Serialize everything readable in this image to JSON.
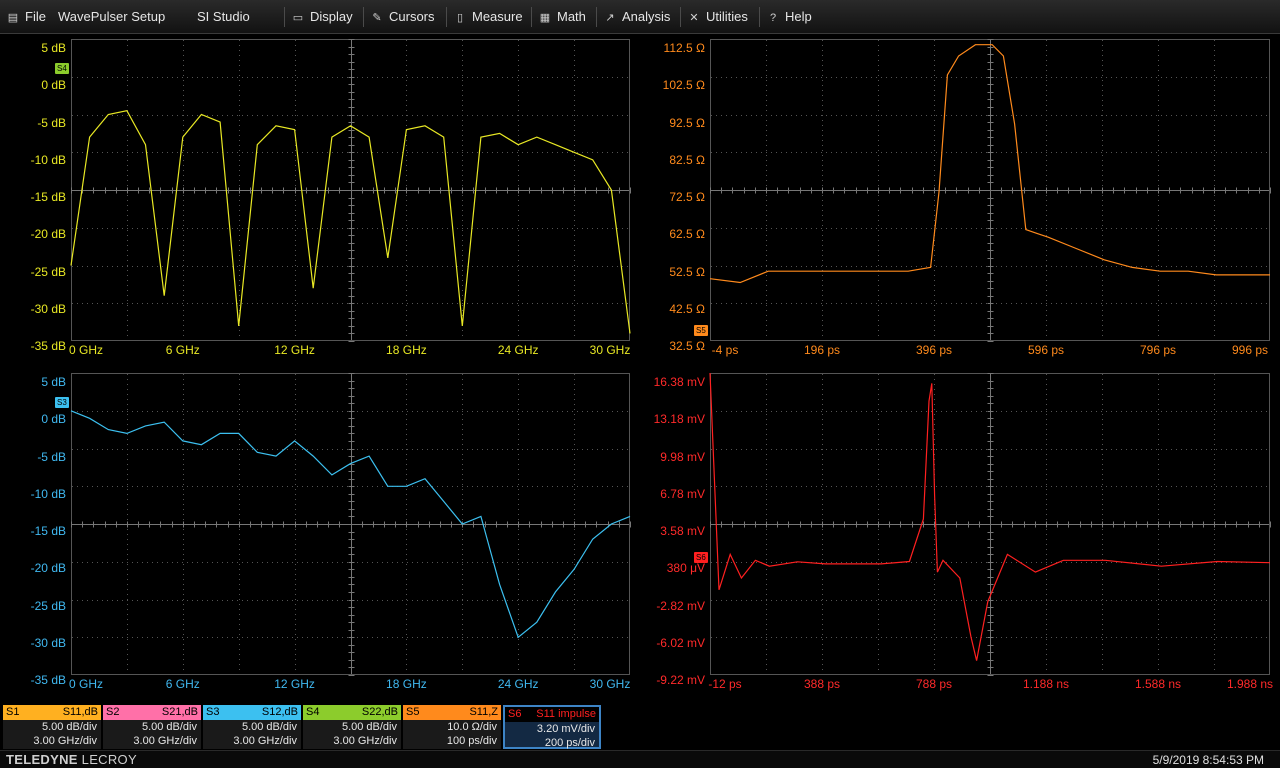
{
  "menubar": {
    "items": [
      {
        "label": "File",
        "icon": "clipboard-icon",
        "glyph": "▤"
      },
      {
        "label": "WavePulser Setup",
        "icon": "",
        "glyph": ""
      },
      {
        "label": "SI Studio",
        "icon": "",
        "glyph": ""
      },
      {
        "label": "Display",
        "icon": "display-icon",
        "glyph": "▭"
      },
      {
        "label": "Cursors",
        "icon": "cursor-icon",
        "glyph": "✎"
      },
      {
        "label": "Measure",
        "icon": "measure-icon",
        "glyph": "▯"
      },
      {
        "label": "Math",
        "icon": "math-icon",
        "glyph": "▦"
      },
      {
        "label": "Analysis",
        "icon": "analysis-icon",
        "glyph": "↗"
      },
      {
        "label": "Utilities",
        "icon": "utilities-icon",
        "glyph": "✕"
      },
      {
        "label": "Help",
        "icon": "help-icon",
        "glyph": "?"
      }
    ]
  },
  "grids": {
    "top_left": {
      "color": "#e8e824",
      "label_color": "#e8e824",
      "y_labels": [
        "5 dB",
        "0 dB",
        "-5 dB",
        "-10 dB",
        "-15 dB",
        "-20 dB",
        "-25 dB",
        "-30 dB",
        "-35 dB"
      ],
      "x_labels": [
        "0 GHz",
        "6 GHz",
        "12 GHz",
        "18 GHz",
        "24 GHz",
        "30 GHz"
      ],
      "marker": {
        "text": "S4",
        "color": "#8ccc2c"
      }
    },
    "bottom_left": {
      "color": "#3cc0f0",
      "label_color": "#40b8f0",
      "y_labels": [
        "5 dB",
        "0 dB",
        "-5 dB",
        "-10 dB",
        "-15 dB",
        "-20 dB",
        "-25 dB",
        "-30 dB",
        "-35 dB"
      ],
      "x_labels": [
        "0 GHz",
        "6 GHz",
        "12 GHz",
        "18 GHz",
        "24 GHz",
        "30 GHz"
      ],
      "marker": {
        "text": "S3",
        "color": "#3cc0f0"
      }
    },
    "top_right": {
      "color": "#ff8a1c",
      "label_color": "#ff8a1c",
      "y_labels": [
        "112.5 Ω",
        "102.5 Ω",
        "92.5 Ω",
        "82.5 Ω",
        "72.5 Ω",
        "62.5 Ω",
        "52.5 Ω",
        "42.5 Ω",
        "32.5 Ω"
      ],
      "x_labels": [
        "-4 ps",
        "196 ps",
        "396 ps",
        "596 ps",
        "796 ps",
        "996 ps"
      ],
      "marker": {
        "text": "S5",
        "color": "#ff8a1c"
      }
    },
    "bottom_right": {
      "color": "#ff2020",
      "label_color": "#ff2a2a",
      "y_labels": [
        "16.38 mV",
        "13.18 mV",
        "9.98 mV",
        "6.78 mV",
        "3.58 mV",
        "380 μV",
        "-2.82 mV",
        "-6.02 mV",
        "-9.22 mV"
      ],
      "x_labels": [
        "-12 ps",
        "388 ps",
        "788 ps",
        "1.188 ns",
        "1.588 ns",
        "1.988 ns"
      ],
      "marker": {
        "text": "S6",
        "color": "#ff2020"
      }
    }
  },
  "chart_data": [
    {
      "type": "line",
      "x": [
        0,
        1,
        2,
        3,
        4,
        5,
        6,
        7,
        8,
        9,
        10,
        11,
        12,
        13,
        14,
        15,
        16,
        17,
        18,
        19,
        20,
        21,
        22,
        23,
        24,
        25,
        26,
        27,
        28,
        29,
        30
      ],
      "series": [
        {
          "values": [
            -25,
            -8,
            -5,
            -4.5,
            -9,
            -29,
            -8,
            -5,
            -6,
            -33,
            -9,
            -6.5,
            -7,
            -28,
            -8,
            -6.5,
            -8,
            -24,
            -7,
            -6.5,
            -8,
            -33,
            -8,
            -7.5,
            -9,
            -8,
            -9,
            -10,
            -11,
            -15,
            -34
          ]
        }
      ],
      "ylim": [
        -35,
        5
      ],
      "xlim": [
        0,
        30
      ]
    },
    {
      "type": "line",
      "x": [
        0,
        1,
        2,
        3,
        4,
        5,
        6,
        7,
        8,
        9,
        10,
        11,
        12,
        13,
        14,
        15,
        16,
        17,
        18,
        19,
        20,
        21,
        22,
        23,
        24,
        25,
        26,
        27,
        28,
        29,
        30
      ],
      "series": [
        {
          "values": [
            0,
            -1,
            -2.5,
            -3,
            -2,
            -1.5,
            -4,
            -4.5,
            -3,
            -3,
            -5.5,
            -6,
            -4,
            -6,
            -8.5,
            -7,
            -6,
            -10,
            -10,
            -9,
            -12,
            -15,
            -14,
            -23,
            -30,
            -28,
            -24,
            -21,
            -17,
            -15,
            -14
          ]
        }
      ],
      "ylim": [
        -35,
        5
      ],
      "xlim": [
        0,
        30
      ]
    },
    {
      "type": "line",
      "x": [
        -4,
        50,
        100,
        150,
        200,
        250,
        300,
        350,
        390,
        405,
        420,
        440,
        470,
        500,
        520,
        540,
        560,
        580,
        600,
        650,
        700,
        750,
        800,
        850,
        900,
        950,
        996
      ],
      "series": [
        {
          "values": [
            49,
            48,
            51,
            51,
            51,
            51,
            51,
            51,
            52,
            72,
            103,
            108,
            111,
            111,
            108,
            90,
            62,
            61,
            60,
            57,
            54,
            52,
            51,
            51,
            50,
            50,
            50
          ]
        }
      ],
      "ylim": [
        32.5,
        112.5
      ],
      "xlim": [
        -4,
        996
      ]
    },
    {
      "type": "line",
      "x": [
        -12,
        20,
        60,
        100,
        150,
        200,
        300,
        400,
        500,
        600,
        700,
        750,
        770,
        780,
        790,
        800,
        820,
        880,
        920,
        940,
        980,
        1050,
        1150,
        1250,
        1400,
        1600,
        1800,
        1988
      ],
      "series": [
        {
          "values": [
            16.38,
            -2,
            1,
            -1,
            0.5,
            0,
            0.38,
            0.2,
            0.2,
            0.2,
            0.4,
            4,
            14,
            15.5,
            6,
            -0.5,
            0.5,
            -1,
            -6,
            -8,
            -3,
            1,
            -0.5,
            0.5,
            0.5,
            0,
            0.4,
            0.3
          ]
        }
      ],
      "ylim": [
        -9.22,
        16.38
      ],
      "xlim": [
        -12,
        1988
      ]
    }
  ],
  "descriptors": [
    {
      "name": "S1",
      "title": "S11,dB",
      "line1": "5.00 dB/div",
      "line2": "3.00 GHz/div",
      "color": "#ffb020",
      "active": false
    },
    {
      "name": "S2",
      "title": "S21,dB",
      "line1": "5.00 dB/div",
      "line2": "3.00 GHz/div",
      "color": "#ff70a8",
      "active": false
    },
    {
      "name": "S3",
      "title": "S12,dB",
      "line1": "5.00 dB/div",
      "line2": "3.00 GHz/div",
      "color": "#3cc0f0",
      "active": false
    },
    {
      "name": "S4",
      "title": "S22,dB",
      "line1": "5.00 dB/div",
      "line2": "3.00 GHz/div",
      "color": "#8ccc2c",
      "active": false
    },
    {
      "name": "S5",
      "title": "S11,Z",
      "line1": "10.0 Ω/div",
      "line2": "100 ps/div",
      "color": "#ff8a1c",
      "active": false
    },
    {
      "name": "S6",
      "title": "S11 impulse",
      "line1": "3.20 mV/div",
      "line2": "200 ps/div",
      "color": "#ff2020",
      "active": true
    }
  ],
  "status": {
    "brand_bold": "TELEDYNE",
    "brand_light": "LECROY",
    "datetime": "5/9/2019 8:54:53 PM"
  }
}
